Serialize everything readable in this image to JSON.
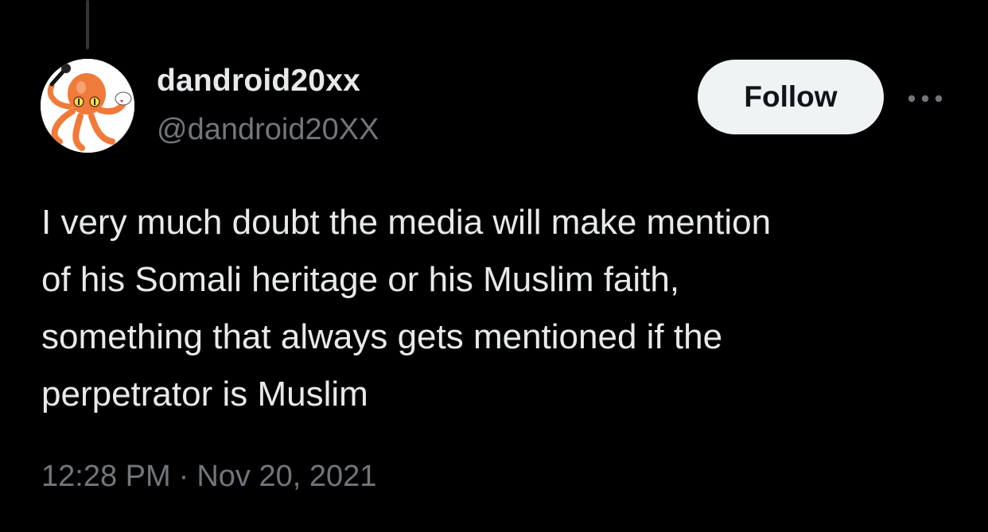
{
  "author": {
    "display_name": "dandroid20xx",
    "handle": "@dandroid20XX",
    "avatar_icon": "octopus-avatar-icon"
  },
  "actions": {
    "follow_label": "Follow",
    "more_icon": "more-options-icon"
  },
  "tweet": {
    "lines": [
      "I very much doubt the media will make mention",
      "of his Somali heritage or his Muslim faith,",
      "something that always gets mentioned if the",
      "perpetrator is Muslim"
    ]
  },
  "meta": {
    "time": "12:28 PM",
    "separator": "·",
    "date": "Nov 20, 2021"
  },
  "colors": {
    "background": "#000000",
    "primary_text": "#e7e9ea",
    "secondary_text": "#71767b",
    "follow_button_bg": "#eff3f4",
    "avatar_accent": "#f07a3a"
  }
}
